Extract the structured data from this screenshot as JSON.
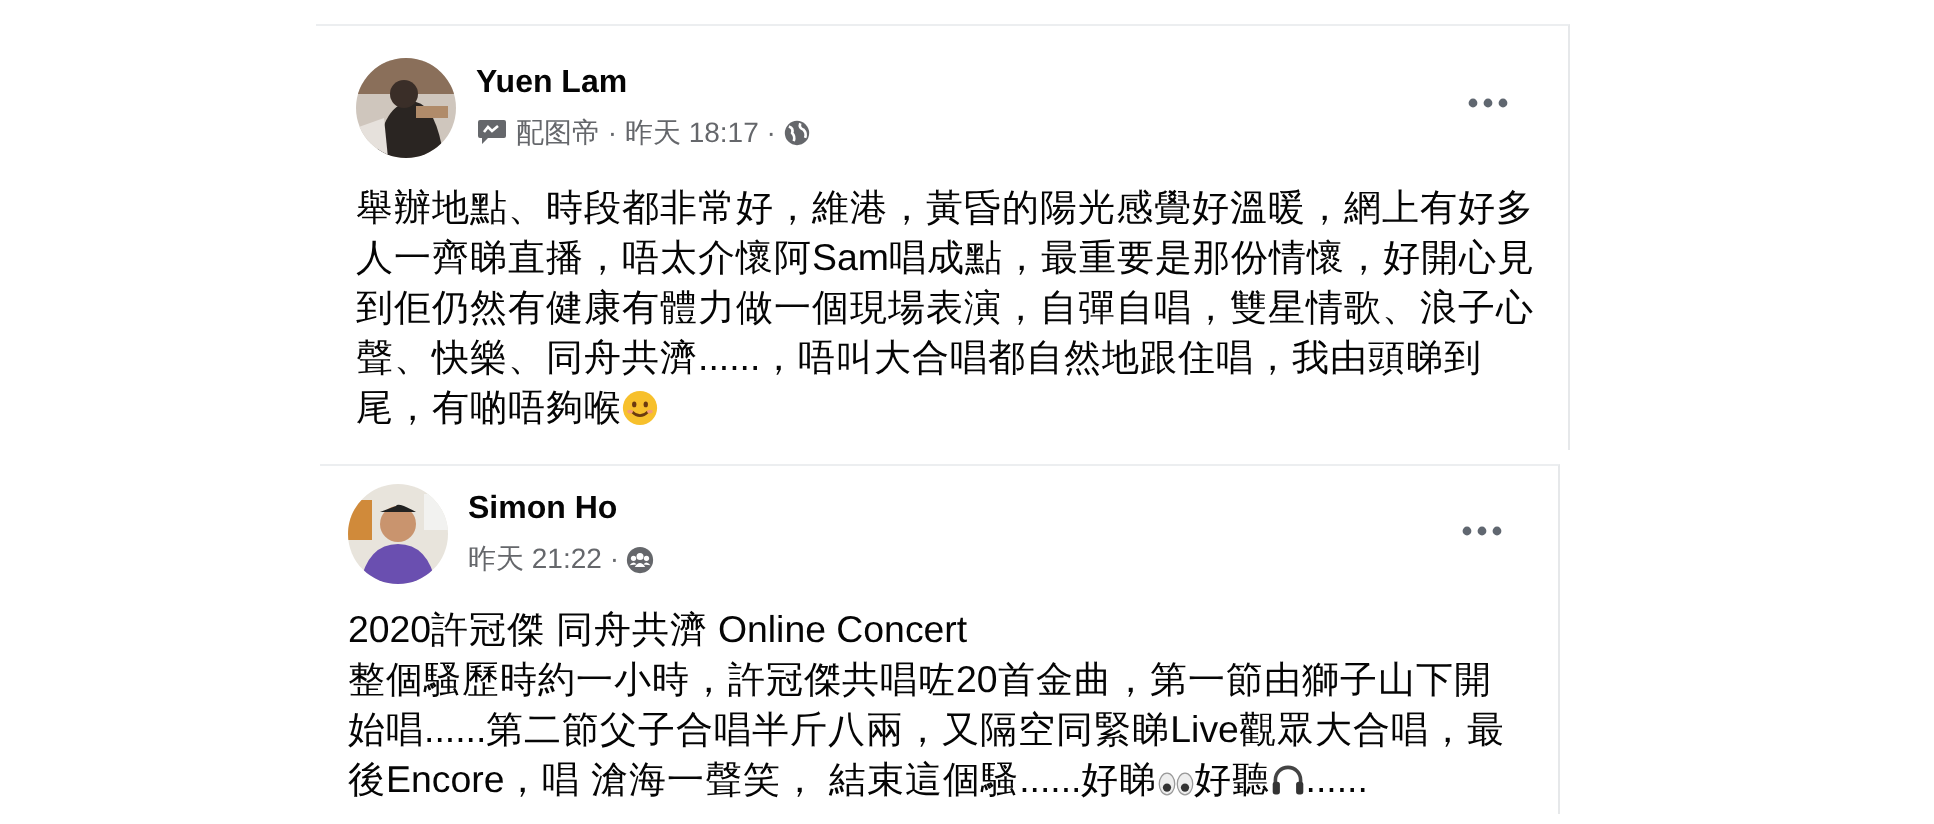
{
  "posts": [
    {
      "author": "Yuen Lam",
      "via_app": true,
      "meta": "配图帝 · 昨天 18:17 ·",
      "audience": {
        "kind": "public"
      },
      "body": [
        [
          {
            "kind": "text",
            "text": "舉辦地點、時段都非常好，維港，黃昏的陽光感覺好溫暖，網上有好多人一齊睇直播，唔太介懷阿Sam唱成點，最重要是那份情懷，好開心見到佢仍然有健康有體力做一個現場表演，自彈自唱，雙星情歌、浪子心聲、快樂、同舟共濟......，唔叫大合唱都自然地跟住唱，我由頭睇到尾，有啲唔夠喉"
          },
          {
            "kind": "smile"
          }
        ]
      ]
    },
    {
      "author": "Simon Ho",
      "via_app": false,
      "meta": "昨天 21:22 ·",
      "audience": {
        "kind": "friends"
      },
      "body": [
        [
          {
            "kind": "text",
            "text": "2020許冠傑 同舟共濟 Online Concert"
          }
        ],
        [
          {
            "kind": "text",
            "text": "整個騷歷時約一小時，許冠傑共唱咗20首金曲，第一節由獅子山下開始唱......第二節父子合唱半斤八兩，又隔空同緊睇Live觀眾大合唱，最後Encore，唱 滄海一聲笑， 結束這個騷......好睇"
          },
          {
            "kind": "eyes"
          },
          {
            "kind": "text",
            "text": "好聽"
          },
          {
            "kind": "headphones"
          },
          {
            "kind": "text",
            "text": "......"
          }
        ]
      ]
    }
  ]
}
